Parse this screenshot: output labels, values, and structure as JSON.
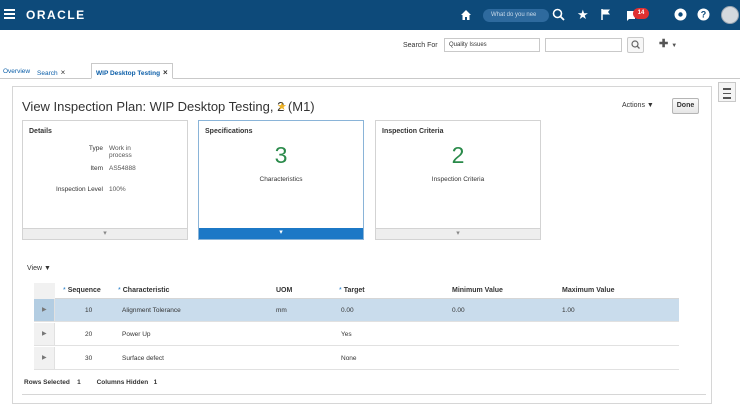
{
  "header": {
    "brand": "ORACLE",
    "global_search_placeholder": "What do you nee",
    "notification_count": "14"
  },
  "search": {
    "label": "Search For",
    "category": "Quality Issues",
    "value": ""
  },
  "tabs": [
    {
      "label": "Overview",
      "active": false,
      "closable": false
    },
    {
      "label": "Search",
      "active": false,
      "closable": true
    },
    {
      "label": "WIP Desktop Testing",
      "active": true,
      "closable": true
    }
  ],
  "page": {
    "title": "View Inspection Plan: WIP Desktop Testing, 2 (M1)",
    "actions_label": "Actions",
    "done_label": "Done"
  },
  "cards": {
    "details": {
      "title": "Details",
      "rows": [
        {
          "label": "Type",
          "value": "Work in process"
        },
        {
          "label": "Item",
          "value": "AS54888"
        },
        {
          "label": "Inspection Level",
          "value": "100%"
        }
      ]
    },
    "specifications": {
      "title": "Specifications",
      "count": "3",
      "subtitle": "Characteristics"
    },
    "criteria": {
      "title": "Inspection Criteria",
      "count": "2",
      "subtitle": "Inspection Criteria"
    }
  },
  "table": {
    "view_label": "View",
    "columns": [
      "Sequence",
      "Characteristic",
      "UOM",
      "Target",
      "Minimum Value",
      "Maximum Value"
    ],
    "required_columns": [
      "Sequence",
      "Characteristic",
      "Target"
    ],
    "rows": [
      {
        "sequence": "10",
        "characteristic": "Alignment Tolerance",
        "uom": "mm",
        "target": "0.00",
        "min": "0.00",
        "max": "1.00",
        "selected": true
      },
      {
        "sequence": "20",
        "characteristic": "Power Up",
        "uom": "",
        "target": "Yes",
        "min": "",
        "max": "",
        "selected": false
      },
      {
        "sequence": "30",
        "characteristic": "Surface defect",
        "uom": "",
        "target": "None",
        "min": "",
        "max": "",
        "selected": false
      }
    ],
    "footer": {
      "rows_selected_label": "Rows Selected",
      "rows_selected": "1",
      "columns_hidden_label": "Columns Hidden",
      "columns_hidden": "1"
    }
  },
  "colors": {
    "header_bg": "#0d4a7a",
    "accent_blue": "#1c78c6",
    "big_number_green": "#2a8a4a",
    "selected_row": "#c9dcec",
    "favorite_star": "#f0b323",
    "badge_red": "#e03131"
  },
  "icons": [
    "hamburger-menu-icon",
    "home-icon",
    "search-icon",
    "star-icon",
    "flag-icon",
    "notifications-icon",
    "gear-icon",
    "help-icon",
    "user-avatar",
    "plus-icon",
    "panel-toggle-icon",
    "expand-row-icon",
    "chevron-down-icon"
  ]
}
